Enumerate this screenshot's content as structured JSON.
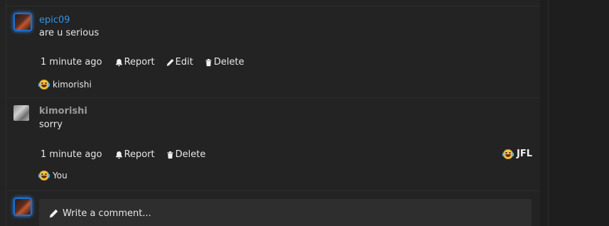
{
  "comments": [
    {
      "username": "epic09",
      "text": "are u serious",
      "time": "1 minute ago",
      "actions": {
        "report": "Report",
        "edit": "Edit",
        "delete": "Delete"
      },
      "reaction_user": "kimorishi"
    },
    {
      "username": "kimorishi",
      "text": "sorry",
      "time": "1 minute ago",
      "actions": {
        "report": "Report",
        "delete": "Delete"
      },
      "reaction_user": "You",
      "reaction_count_label": "JFL"
    }
  ],
  "composer": {
    "placeholder": "Write a comment..."
  },
  "icons": {
    "report": "bell-icon",
    "edit": "pencil-icon",
    "delete": "trash-icon",
    "reaction": "laughing-crying-emoji-icon"
  },
  "colors": {
    "username_accent": "#2f95ea",
    "avatar_glow": "#2b8cff",
    "background": "#232323"
  }
}
